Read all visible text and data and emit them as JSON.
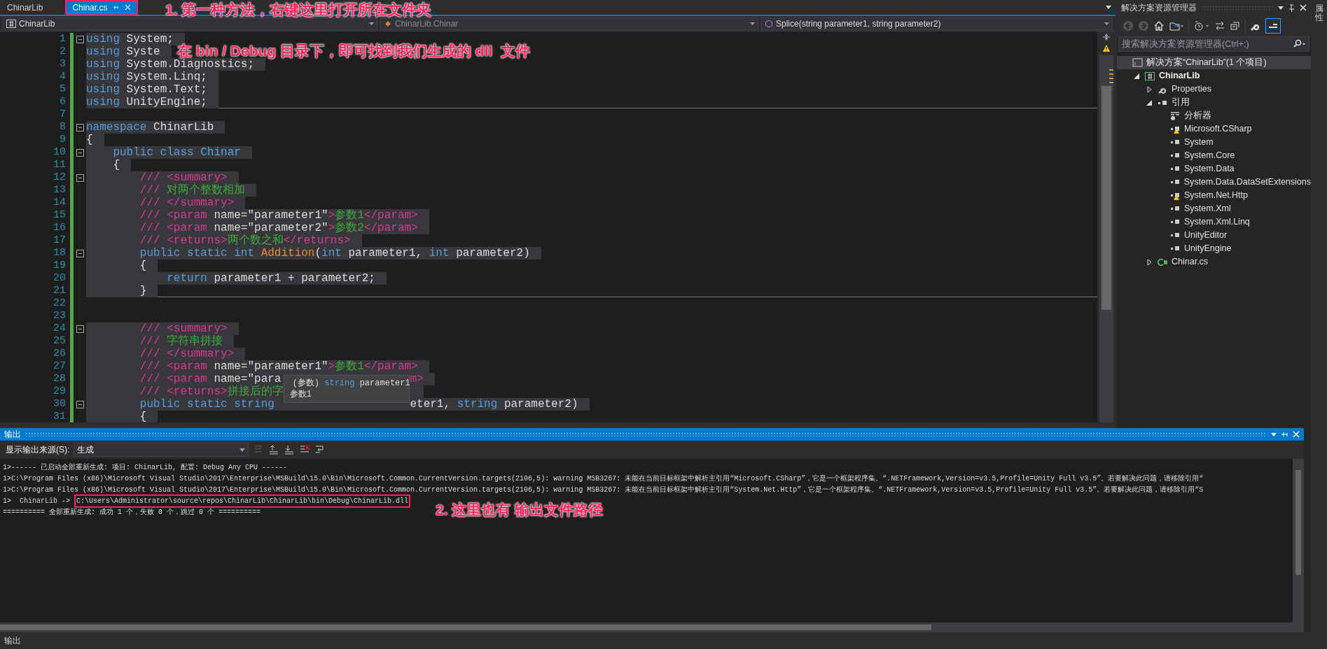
{
  "doc_tabs": [
    {
      "label": "ChinarLib",
      "selected": false,
      "annotated": false
    },
    {
      "label": "Chinar.cs",
      "selected": true,
      "annotated": true
    }
  ],
  "nav_bar": {
    "project": "ChinarLib",
    "type": "ChinarLib.Chinar",
    "member": "Splice(string parameter1, string parameter2)"
  },
  "editor": {
    "lines": [
      {
        "number": "1",
        "fold": true,
        "highlighted": true,
        "separator_after": false,
        "tokens": [
          {
            "kind": "kw",
            "text": "using"
          },
          {
            "kind": "plain",
            "text": " System;"
          }
        ]
      },
      {
        "number": "2",
        "fold": false,
        "highlighted": true,
        "separator_after": false,
        "tokens": [
          {
            "kind": "kw",
            "text": "using"
          },
          {
            "kind": "plain",
            "text": " Syste"
          }
        ]
      },
      {
        "number": "3",
        "fold": false,
        "highlighted": true,
        "separator_after": false,
        "tokens": [
          {
            "kind": "kw",
            "text": "using"
          },
          {
            "kind": "plain",
            "text": " System.Diagnostics;"
          }
        ]
      },
      {
        "number": "4",
        "fold": false,
        "highlighted": true,
        "separator_after": false,
        "tokens": [
          {
            "kind": "kw",
            "text": "using"
          },
          {
            "kind": "plain",
            "text": " System.Linq;"
          }
        ]
      },
      {
        "number": "5",
        "fold": false,
        "highlighted": true,
        "separator_after": false,
        "tokens": [
          {
            "kind": "kw",
            "text": "using"
          },
          {
            "kind": "plain",
            "text": " System.Text;"
          }
        ]
      },
      {
        "number": "6",
        "fold": false,
        "highlighted": true,
        "separator_after": true,
        "tokens": [
          {
            "kind": "kw",
            "text": "using"
          },
          {
            "kind": "plain",
            "text": " UnityEngine;"
          }
        ]
      },
      {
        "number": "7",
        "fold": false,
        "highlighted": false,
        "separator_after": false
      },
      {
        "number": "8",
        "fold": true,
        "highlighted": true,
        "separator_after": false,
        "tokens": [
          {
            "kind": "kw",
            "text": "namespace"
          },
          {
            "kind": "plain",
            "text": " ChinarLib"
          }
        ]
      },
      {
        "number": "9",
        "fold": false,
        "highlighted": true,
        "separator_after": false,
        "tokens": [
          {
            "kind": "plain",
            "text": "{"
          }
        ]
      },
      {
        "number": "10",
        "fold": true,
        "highlighted": true,
        "separator_after": false,
        "tokens": [
          {
            "kind": "kw",
            "text": "    public class"
          },
          {
            "kind": "type",
            "text": " Chinar"
          }
        ]
      },
      {
        "number": "11",
        "fold": false,
        "highlighted": true,
        "separator_after": false,
        "tokens": [
          {
            "kind": "plain",
            "text": "    {"
          }
        ]
      },
      {
        "number": "12",
        "fold": true,
        "highlighted": true,
        "separator_after": false,
        "tokens": [
          {
            "kind": "doc",
            "text": "        /// <summary>"
          }
        ]
      },
      {
        "number": "13",
        "fold": false,
        "highlighted": true,
        "separator_after": false,
        "tokens": [
          {
            "kind": "doc",
            "text": "        /// "
          },
          {
            "kind": "doctext",
            "text": "对两个整数相加"
          }
        ]
      },
      {
        "number": "14",
        "fold": false,
        "highlighted": true,
        "separator_after": false,
        "tokens": [
          {
            "kind": "doc",
            "text": "        /// </summary>"
          }
        ]
      },
      {
        "number": "15",
        "fold": false,
        "highlighted": true,
        "separator_after": false,
        "tokens": [
          {
            "kind": "doc",
            "text": "        /// <param"
          },
          {
            "kind": "plain",
            "text": " name=\"parameter1\""
          },
          {
            "kind": "doc",
            "text": ">"
          },
          {
            "kind": "doctext",
            "text": "参数1"
          },
          {
            "kind": "doc",
            "text": "</param>"
          }
        ]
      },
      {
        "number": "16",
        "fold": false,
        "highlighted": true,
        "separator_after": false,
        "tokens": [
          {
            "kind": "doc",
            "text": "        /// <param"
          },
          {
            "kind": "plain",
            "text": " name=\"parameter2\""
          },
          {
            "kind": "doc",
            "text": ">"
          },
          {
            "kind": "doctext",
            "text": "参数2"
          },
          {
            "kind": "doc",
            "text": "</param>"
          }
        ]
      },
      {
        "number": "17",
        "fold": false,
        "highlighted": true,
        "separator_after": false,
        "tokens": [
          {
            "kind": "doc",
            "text": "        /// <returns>"
          },
          {
            "kind": "doctext",
            "text": "两个数之和"
          },
          {
            "kind": "doc",
            "text": "</returns>"
          }
        ]
      },
      {
        "number": "18",
        "fold": true,
        "highlighted": true,
        "separator_after": false,
        "tokens": [
          {
            "kind": "kw",
            "text": "        public static int"
          },
          {
            "kind": "method",
            "text": " Addition"
          },
          {
            "kind": "plain",
            "text": "("
          },
          {
            "kind": "kw",
            "text": "int"
          },
          {
            "kind": "plain",
            "text": " parameter1, "
          },
          {
            "kind": "kw",
            "text": "int"
          },
          {
            "kind": "plain",
            "text": " parameter2)"
          }
        ]
      },
      {
        "number": "19",
        "fold": false,
        "highlighted": true,
        "separator_after": false,
        "tokens": [
          {
            "kind": "plain",
            "text": "        {"
          }
        ]
      },
      {
        "number": "20",
        "fold": false,
        "highlighted": true,
        "separator_after": false,
        "tokens": [
          {
            "kind": "kw",
            "text": "            return"
          },
          {
            "kind": "plain",
            "text": " parameter1 + parameter2;"
          }
        ]
      },
      {
        "number": "21",
        "fold": false,
        "highlighted": true,
        "separator_after": true,
        "tokens": [
          {
            "kind": "plain",
            "text": "        }"
          }
        ]
      },
      {
        "number": "22",
        "fold": false,
        "highlighted": false,
        "separator_after": false
      },
      {
        "number": "23",
        "fold": false,
        "highlighted": false,
        "separator_after": false
      },
      {
        "number": "24",
        "fold": true,
        "highlighted": true,
        "separator_after": false,
        "tokens": [
          {
            "kind": "doc",
            "text": "        /// <summary>"
          }
        ]
      },
      {
        "number": "25",
        "fold": false,
        "highlighted": true,
        "separator_after": false,
        "tokens": [
          {
            "kind": "doc",
            "text": "        /// "
          },
          {
            "kind": "doctext",
            "text": "字符串拼接"
          }
        ]
      },
      {
        "number": "26",
        "fold": false,
        "highlighted": true,
        "separator_after": false,
        "tokens": [
          {
            "kind": "doc",
            "text": "        /// </summary>"
          }
        ]
      },
      {
        "number": "27",
        "fold": false,
        "highlighted": true,
        "separator_after": false,
        "tokens": [
          {
            "kind": "doc",
            "text": "        /// <param"
          },
          {
            "kind": "plain",
            "text": " name=\"parameter1\""
          },
          {
            "kind": "doc",
            "text": ">"
          },
          {
            "kind": "doctext",
            "text": "参数1"
          },
          {
            "kind": "doc",
            "text": "</param>"
          }
        ]
      },
      {
        "number": "28",
        "fold": false,
        "highlighted": true,
        "separator_after": false,
        "tokens": [
          {
            "kind": "doc",
            "text": "        /// <param"
          },
          {
            "kind": "plain",
            "text": " name=\"para"
          },
          {
            "kind": "covered"
          },
          {
            "kind": "doc",
            "text": "m>"
          }
        ]
      },
      {
        "number": "29",
        "fold": false,
        "highlighted": true,
        "separator_after": false,
        "tokens": [
          {
            "kind": "doc",
            "text": "        /// <returns>"
          },
          {
            "kind": "doctext",
            "text": "拼接后的字"
          },
          {
            "kind": "covered"
          }
        ]
      },
      {
        "number": "30",
        "fold": true,
        "highlighted": true,
        "separator_after": false,
        "tokens": [
          {
            "kind": "kw",
            "text": "        public static string "
          },
          {
            "kind": "covered"
          },
          {
            "kind": "plain",
            "text": "eter1, "
          },
          {
            "kind": "kw",
            "text": "string"
          },
          {
            "kind": "plain",
            "text": " parameter2)"
          }
        ]
      },
      {
        "number": "31",
        "fold": false,
        "highlighted": true,
        "separator_after": false,
        "tokens": [
          {
            "kind": "plain",
            "text": "        {"
          }
        ]
      }
    ]
  },
  "tooltip": {
    "kind_label": "(参数)",
    "type": "string",
    "name": "parameter1",
    "description": "参数1"
  },
  "solution_explorer": {
    "title": "解决方案资源管理器",
    "search": {
      "placeholder": "搜索解决方案资源管理器(Ctrl+;)"
    },
    "tree": [
      {
        "label": "解决方案“ChinarLib”(1 个项目)",
        "kind": "solution",
        "selected": true,
        "children": [
          {
            "label": "ChinarLib",
            "kind": "project",
            "selected": false,
            "expanded": true,
            "children": [
              {
                "label": "Properties",
                "kind": "properties",
                "selected": false,
                "expanded": false
              },
              {
                "label": "引用",
                "kind": "references",
                "selected": false,
                "expanded": true,
                "children": [
                  {
                    "label": "分析器",
                    "kind": "analyzer",
                    "selected": false
                  },
                  {
                    "label": "Microsoft.CSharp",
                    "kind": "reference",
                    "selected": false,
                    "warning": true
                  },
                  {
                    "label": "System",
                    "kind": "reference",
                    "selected": false,
                    "warning": false
                  },
                  {
                    "label": "System.Core",
                    "kind": "reference",
                    "selected": false,
                    "warning": false
                  },
                  {
                    "label": "System.Data",
                    "kind": "reference",
                    "selected": false,
                    "warning": false
                  },
                  {
                    "label": "System.Data.DataSetExtensions",
                    "kind": "reference",
                    "selected": false,
                    "warning": false
                  },
                  {
                    "label": "System.Net.Http",
                    "kind": "reference",
                    "selected": false,
                    "warning": true
                  },
                  {
                    "label": "System.Xml",
                    "kind": "reference",
                    "selected": false,
                    "warning": false
                  },
                  {
                    "label": "System.Xml.Linq",
                    "kind": "reference",
                    "selected": false,
                    "warning": false
                  },
                  {
                    "label": "UnityEditor",
                    "kind": "reference",
                    "selected": false,
                    "warning": false
                  },
                  {
                    "label": "UnityEngine",
                    "kind": "reference",
                    "selected": false,
                    "warning": false
                  }
                ]
              },
              {
                "label": "Chinar.cs",
                "kind": "csfile",
                "selected": false,
                "expanded": false
              }
            ]
          }
        ]
      }
    ]
  },
  "side_tab": "属性",
  "output": {
    "title": "输出",
    "source_label": "显示输出来源(S):",
    "source": "生成",
    "lines": [
      {
        "text": "1>------ 已启动全部重新生成: 项目: ChinarLib, 配置: Debug Any CPU ------"
      },
      {
        "text": "1>C:\\Program Files (x86)\\Microsoft Visual Studio\\2017\\Enterprise\\MSBuild\\15.0\\Bin\\Microsoft.Common.CurrentVersion.targets(2106,5): warning MSB3267: 未能在当前目标框架中解析主引用“Microsoft.CSharp”，它是一个框架程序集。“.NETFramework,Version=v3.5,Profile=Unity Full v3.5”。若要解决此问题，请移除引用“"
      },
      {
        "text": "1>C:\\Program Files (x86)\\Microsoft Visual Studio\\2017\\Enterprise\\MSBuild\\15.0\\Bin\\Microsoft.Common.CurrentVersion.targets(2106,5): warning MSB3267: 未能在当前目标框架中解析主引用“System.Net.Http”，它是一个框架程序集。“.NETFramework,Version=v3.5,Profile=Unity Full v3.5”。若要解决此问题，请移除引用“S"
      },
      {
        "text": "1>  ChinarLib -> ",
        "path": "C:\\Users\\Administrator\\source\\repos\\ChinarLib\\ChinarLib\\bin\\Debug\\ChinarLib.dll",
        "path_boxed": true
      },
      {
        "text": "========== 全部重新生成: 成功 1 个，失败 0 个，跳过 0 个 =========="
      }
    ]
  },
  "status_bar": {
    "text": "输出"
  },
  "annotations": [
    {
      "kind": "tab-note",
      "text": "1. 第一种方法，右键这里打开所在文件夹"
    },
    {
      "kind": "editor-note",
      "text": "在 bin / Debug 目录下，即可找到我们生成的 dll  文件"
    },
    {
      "kind": "output-note",
      "text": "2. 这里也有 输出文件路径"
    }
  ]
}
